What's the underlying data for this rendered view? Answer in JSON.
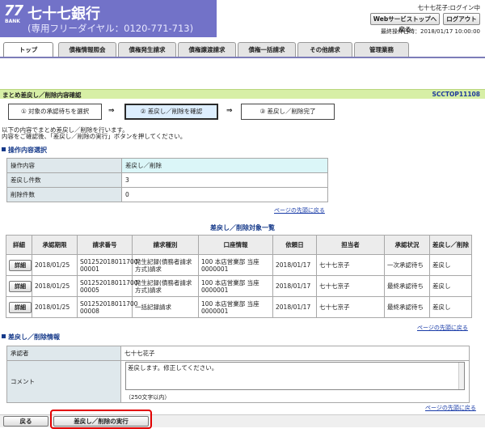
{
  "header": {
    "logo_number": "77",
    "logo_bank": "BANK",
    "bank_name": "七十七銀行",
    "tel": "(専用フリーダイヤル：0120-771-713)",
    "user_status": "七十七花子:ログイン中",
    "back_to_top_label": "Webサービストップへ戻る",
    "logout_label": "ログアウト",
    "last_operation": "最終操作日時：2018/01/17 10:00:00"
  },
  "tabs": [
    "トップ",
    "債権情報照会",
    "債権発生請求",
    "債権譲渡請求",
    "債権一括請求",
    "その他請求",
    "管理業務"
  ],
  "page": {
    "title": "まとめ差戻し／削除内容確認",
    "code": "SCCTOP11108"
  },
  "steps": [
    "① 対象の承認待ちを選択",
    "② 差戻し／削除を確認",
    "③ 差戻し／削除完了"
  ],
  "step_arrow": "⇒",
  "instructions": [
    "以下の内容でまとめ差戻し／削除を行います。",
    "内容をご確認後、「差戻し／削除の実行」ボタンを押してください。"
  ],
  "operation_section": {
    "title": "操作内容選択",
    "rows": [
      {
        "label": "操作内容",
        "value": "差戻し／削除"
      },
      {
        "label": "差戻し件数",
        "value": "3"
      },
      {
        "label": "削除件数",
        "value": "0"
      }
    ]
  },
  "page_top_link": "ページの先頭に戻る",
  "list": {
    "title": "差戻し／削除対象一覧",
    "headers": [
      "詳細",
      "承認期限",
      "請求番号",
      "請求種別",
      "口座情報",
      "依頼日",
      "担当者",
      "承認状況",
      "差戻し／削除"
    ],
    "detail_label": "詳細",
    "rows": [
      {
        "deadline": "2018/01/25",
        "req_no": "S01252018011700 00001",
        "type": "発生記録(債務者請求方式)請求",
        "account": "100 本店営業部 当座 0000001",
        "date": "2018/01/17",
        "person": "七十七京子",
        "status": "一次承認待ち",
        "action": "差戻し"
      },
      {
        "deadline": "2018/01/25",
        "req_no": "S01252018011700 00005",
        "type": "発生記録(債務者請求方式)請求",
        "account": "100 本店営業部 当座 0000001",
        "date": "2018/01/17",
        "person": "七十七京子",
        "status": "最終承認待ち",
        "action": "差戻し"
      },
      {
        "deadline": "2018/01/25",
        "req_no": "S01252018011700 00008",
        "type": "一括記録請求",
        "account": "100 本店営業部 当座 0000001",
        "date": "2018/01/17",
        "person": "七十七京子",
        "status": "最終承認待ち",
        "action": "差戻し"
      }
    ]
  },
  "info_section": {
    "title": "差戻し／削除情報",
    "approver_label": "承認者",
    "approver_value": "七十七花子",
    "comment_label": "コメント",
    "comment_value": "差戻します。修正してください。",
    "comment_limit": "（250文字以内）"
  },
  "buttons": {
    "back": "戻る",
    "execute": "差戻し／削除の実行"
  },
  "colors": {
    "header_bg": "#7272c8",
    "title_bar": "#d7efa6",
    "section_title": "#163a8a",
    "highlight_box": "#e20000"
  }
}
